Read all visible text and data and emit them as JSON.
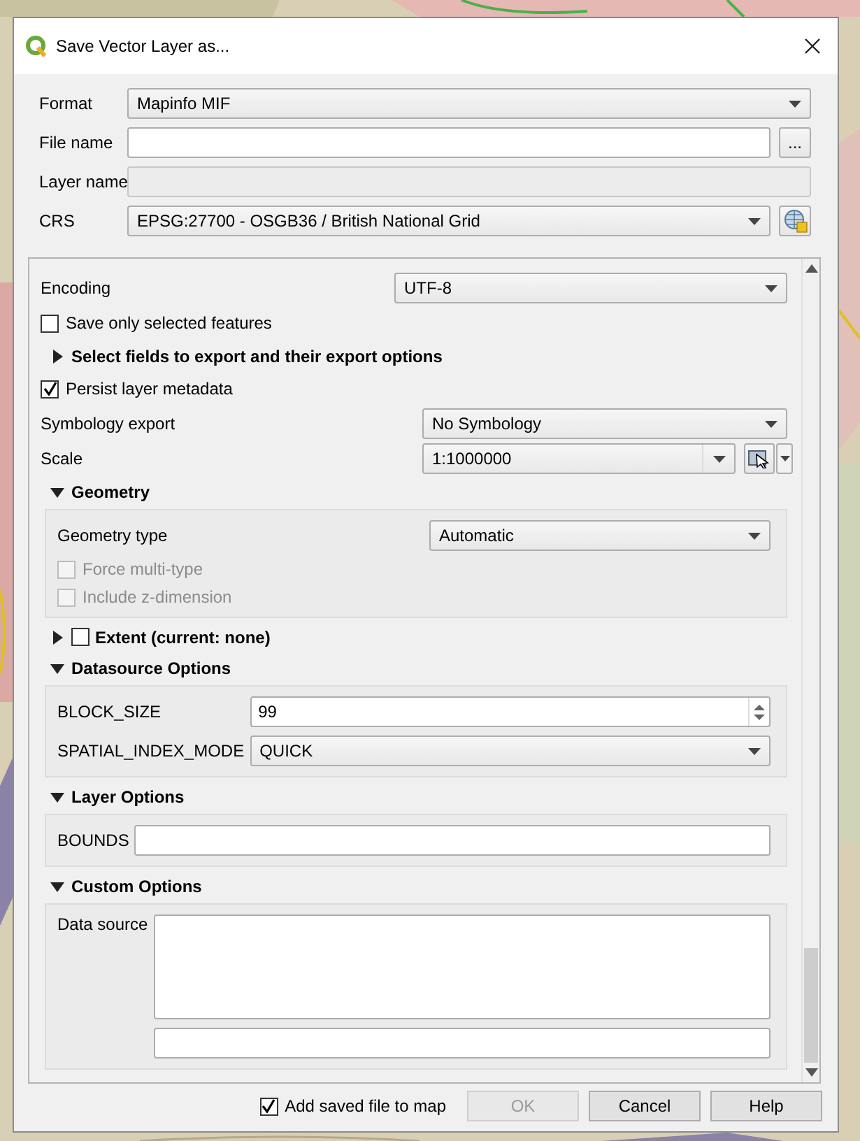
{
  "window": {
    "title": "Save Vector Layer as..."
  },
  "fields": [
    {
      "label": "Format",
      "kind": "combo",
      "value": "Mapinfo MIF"
    },
    {
      "label": "File name",
      "kind": "file",
      "button": "..."
    },
    {
      "label": "Layer name",
      "kind": "text",
      "disabled": true
    },
    {
      "label": "CRS",
      "kind": "crs",
      "value": "EPSG:27700 - OSGB36 / British National Grid"
    }
  ],
  "encoding": {
    "label": "Encoding",
    "value": "UTF-8"
  },
  "save_selected": {
    "label": "Save only selected features",
    "checked": false
  },
  "select_fields": {
    "label": "Select fields to export and their export options",
    "expanded": false
  },
  "persist_metadata": {
    "label": "Persist layer metadata",
    "checked": true
  },
  "symbology_export": {
    "label": "Symbology export",
    "value": "No Symbology"
  },
  "scale": {
    "label": "Scale",
    "value": "1:1000000"
  },
  "sections": [
    {
      "title": "Geometry",
      "expanded": true,
      "rows": [
        {
          "kind": "combo",
          "label": "Geometry type",
          "value": "Automatic"
        },
        {
          "kind": "checkbox",
          "label": "Force multi-type",
          "checked": false,
          "disabled": true
        },
        {
          "kind": "checkbox",
          "label": "Include z-dimension",
          "checked": false,
          "disabled": true
        }
      ]
    },
    {
      "title": "Extent (current: none)",
      "expanded": false,
      "checked": false
    },
    {
      "title": "Datasource Options",
      "expanded": true,
      "rows": [
        {
          "kind": "spin",
          "label": "BLOCK_SIZE",
          "value": "99"
        },
        {
          "kind": "combo",
          "label": "SPATIAL_INDEX_MODE",
          "value": "QUICK"
        }
      ]
    },
    {
      "title": "Layer Options",
      "expanded": true,
      "rows": [
        {
          "kind": "text",
          "label": "BOUNDS"
        }
      ]
    },
    {
      "title": "Custom Options",
      "expanded": true,
      "rows": [
        {
          "kind": "textarea",
          "label": "Data source"
        },
        {
          "kind": "text"
        }
      ]
    }
  ],
  "footer": {
    "add_to_map": {
      "label": "Add saved file to map",
      "checked": true
    },
    "buttons": [
      {
        "label": "OK",
        "disabled": true
      },
      {
        "label": "Cancel",
        "disabled": false
      },
      {
        "label": "Help",
        "disabled": false
      }
    ]
  }
}
